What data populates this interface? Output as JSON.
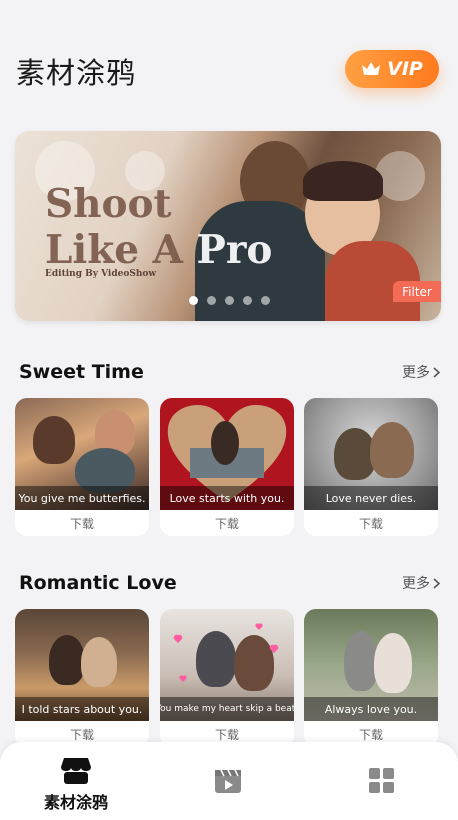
{
  "header": {
    "title": "素材涂鸦",
    "vip_label": "VIP"
  },
  "banner": {
    "title_line1": "Shoot",
    "title_line2_a": "Like A ",
    "title_line2_b": "Pro",
    "subtitle": "Editing By VideoShow",
    "tag": "Filter",
    "page_count": 5,
    "active_page": 1
  },
  "sections": [
    {
      "title": "Sweet Time",
      "more_label": "更多",
      "cards": [
        {
          "caption": "You give me butterfies.",
          "download_label": "下载"
        },
        {
          "caption": "Love  starts with you.",
          "download_label": "下载"
        },
        {
          "caption": "Love never dies.",
          "download_label": "下载"
        }
      ]
    },
    {
      "title": "Romantic Love",
      "more_label": "更多",
      "cards": [
        {
          "caption": "I told stars about you.",
          "download_label": "下载"
        },
        {
          "caption": "You make my heart skip a beat.",
          "download_label": "下载"
        },
        {
          "caption": "Always love you.",
          "download_label": "下载"
        }
      ]
    }
  ],
  "tabbar": {
    "items": [
      {
        "label": "素材涂鸦",
        "icon": "store-icon",
        "active": true
      },
      {
        "label": "",
        "icon": "video-clapper-icon",
        "active": false
      },
      {
        "label": "",
        "icon": "grid-apps-icon",
        "active": false
      }
    ]
  },
  "colors": {
    "accent": "#ff8a2a",
    "filter_tag": "#f36a55",
    "inactive_icon": "#8a8a8a"
  }
}
